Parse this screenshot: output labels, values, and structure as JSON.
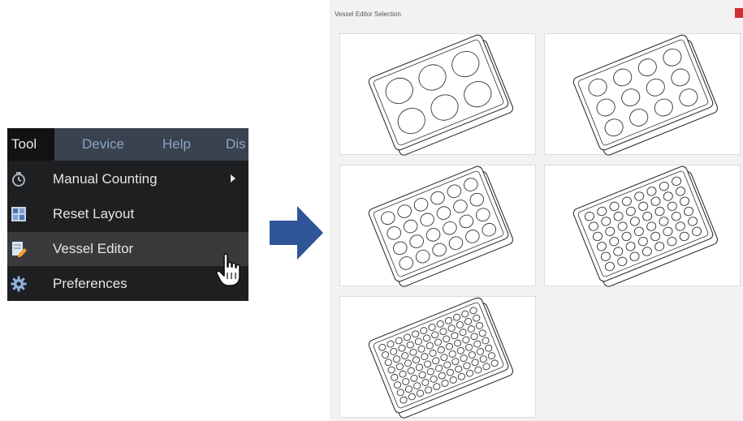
{
  "menu": {
    "bar": {
      "tool": "Tool",
      "device": "Device",
      "help": "Help",
      "dis": "Dis"
    },
    "items": [
      {
        "label": "Manual Counting",
        "icon": "counter-icon",
        "has_submenu": true
      },
      {
        "label": "Reset Layout",
        "icon": "reset-layout-icon",
        "has_submenu": false
      },
      {
        "label": "Vessel Editor",
        "icon": "vessel-editor-icon",
        "has_submenu": false,
        "hovered": true
      },
      {
        "label": "Preferences",
        "icon": "gear-icon",
        "has_submenu": false
      }
    ]
  },
  "dialog": {
    "title": "Vessel Editor Selection",
    "close_color": "#cc3030",
    "plates": [
      {
        "name": "6-well plate",
        "rows": 2,
        "cols": 3
      },
      {
        "name": "12-well plate",
        "rows": 3,
        "cols": 4
      },
      {
        "name": "24-well plate",
        "rows": 4,
        "cols": 6
      },
      {
        "name": "48-well plate",
        "rows": 6,
        "cols": 8
      },
      {
        "name": "96-well plate",
        "rows": 8,
        "cols": 12
      }
    ]
  },
  "colors": {
    "menu_bg": "#1e1f21",
    "menubar_bg": "#39424e",
    "menubar_text": "#8da2c2",
    "hover_bg": "#3a3a3c",
    "arrow": "#2f5597"
  }
}
